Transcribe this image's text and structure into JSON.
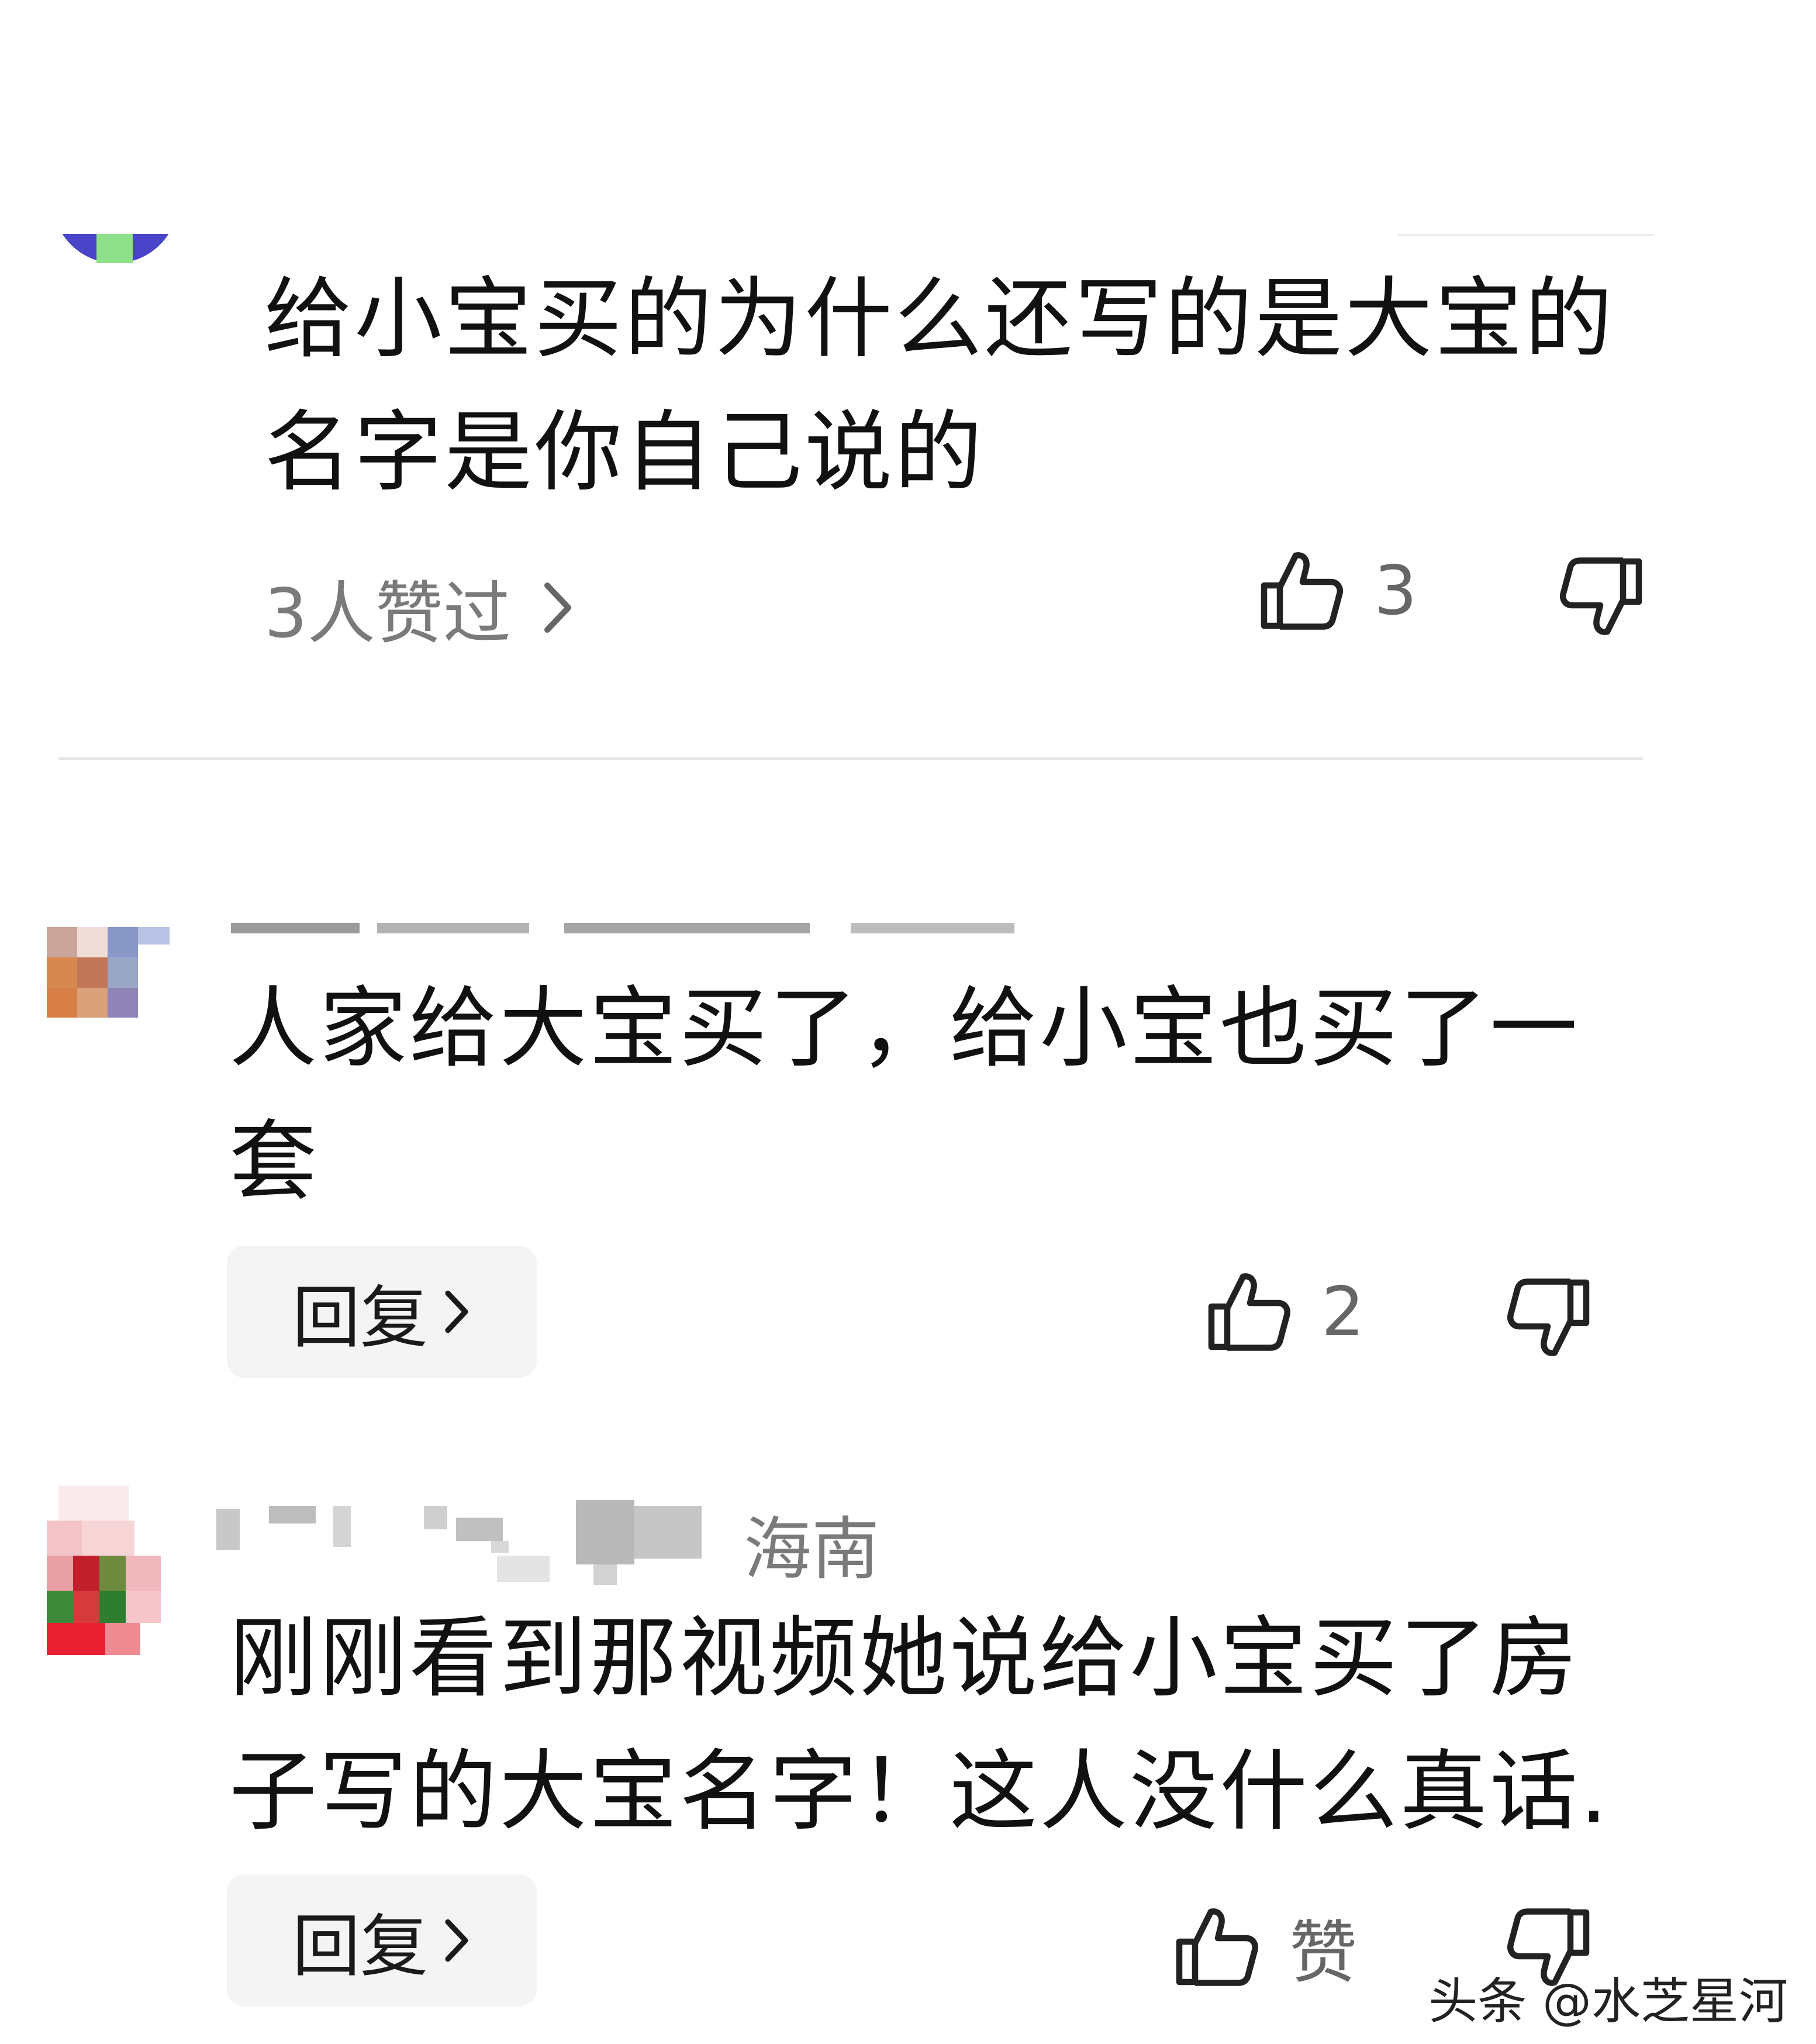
{
  "comments": [
    {
      "text_line1": "给小宝买的为什么还写的是大宝的",
      "text_line2": "名字是你自己说的",
      "liked_by": "3人赞过",
      "like_count": "3"
    },
    {
      "text_line1": "人家给大宝买了，给小宝也买了一",
      "text_line2": "套",
      "reply_label": "回复",
      "like_count": "2"
    },
    {
      "location": "海南",
      "text_line1": "刚刚看到那视频她说给小宝买了房",
      "text_line2": "子写的大宝名字！这人没什么真话.",
      "reply_label": "回复",
      "like_label": "赞"
    }
  ],
  "watermark": "头条 @水芝星河",
  "icons": {
    "chevron": "chevron-right-icon",
    "like": "thumbs-up-icon",
    "dislike": "thumbs-down-icon"
  }
}
